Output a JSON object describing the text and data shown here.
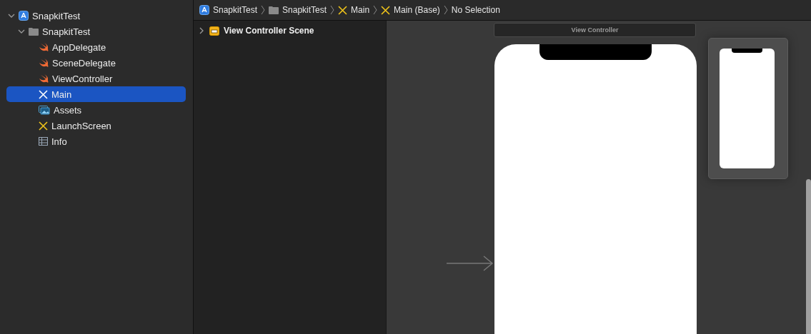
{
  "navigator": {
    "items": [
      {
        "label": "SnapkitTest",
        "kind": "project",
        "expanded": true,
        "selected": false,
        "children": [
          {
            "label": "SnapkitTest",
            "kind": "folder",
            "expanded": true,
            "selected": false,
            "children": [
              {
                "label": "AppDelegate",
                "kind": "swift",
                "selected": false
              },
              {
                "label": "SceneDelegate",
                "kind": "swift",
                "selected": false
              },
              {
                "label": "ViewController",
                "kind": "swift",
                "selected": false
              },
              {
                "label": "Main",
                "kind": "storyboard",
                "selected": true
              },
              {
                "label": "Assets",
                "kind": "assets",
                "selected": false
              },
              {
                "label": "LaunchScreen",
                "kind": "storyboard",
                "selected": false
              },
              {
                "label": "Info",
                "kind": "plist",
                "selected": false
              }
            ]
          }
        ]
      }
    ]
  },
  "breadcrumb": [
    {
      "label": "SnapkitTest",
      "kind": "project"
    },
    {
      "label": "SnapkitTest",
      "kind": "folder"
    },
    {
      "label": "Main",
      "kind": "storyboard"
    },
    {
      "label": "Main (Base)",
      "kind": "storyboard"
    },
    {
      "label": "No Selection",
      "kind": "none"
    }
  ],
  "outline": {
    "items": [
      {
        "label": "View Controller Scene",
        "expanded": false
      }
    ]
  },
  "canvas": {
    "scene_title": "View Controller"
  }
}
